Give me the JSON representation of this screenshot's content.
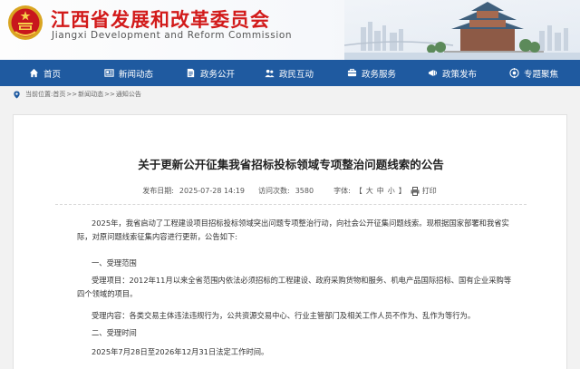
{
  "header": {
    "title": "江西省发展和改革委员会",
    "subtitle": "Jiangxi Development and Reform Commission"
  },
  "nav": {
    "items": [
      {
        "label": "首页",
        "icon": "home-icon"
      },
      {
        "label": "新闻动态",
        "icon": "news-icon"
      },
      {
        "label": "政务公开",
        "icon": "document-icon"
      },
      {
        "label": "政民互动",
        "icon": "people-icon"
      },
      {
        "label": "政务服务",
        "icon": "service-icon"
      },
      {
        "label": "政策发布",
        "icon": "policy-icon"
      },
      {
        "label": "专题聚焦",
        "icon": "focus-icon"
      }
    ]
  },
  "breadcrumb": {
    "prefix": "当前位置:",
    "items": [
      "首页",
      "新闻动态",
      "通知公告"
    ],
    "separator": ">>"
  },
  "article": {
    "title": "关于更新公开征集我省招标投标领域专项整治问题线索的公告",
    "publish_label": "发布日期:",
    "publish_date": "2025-07-28 14:19",
    "views_label": "访问次数:",
    "views": "3580",
    "font_label": "字体:",
    "font_open": "【",
    "font_large": "大",
    "font_medium": "中",
    "font_small": "小",
    "font_close": "】",
    "print_label": "打印",
    "paragraphs": [
      "2025年，我省启动了工程建设项目招标投标领域突出问题专项整治行动，向社会公开征集问题线索。现根据国家部署和我省实际，对原问题线索征集内容进行更新，公告如下:",
      "一、受理范围",
      "受理项目：2012年11月以来全省范围内依法必须招标的工程建设、政府采购货物和服务、机电产品国际招标、国有企业采购等四个领域的项目。",
      "受理内容：各类交易主体违法违规行为，公共资源交易中心、行业主管部门及相关工作人员不作为、乱作为等行为。",
      "二、受理时间",
      "2025年7月28日至2026年12月31日法定工作时间。"
    ]
  }
}
